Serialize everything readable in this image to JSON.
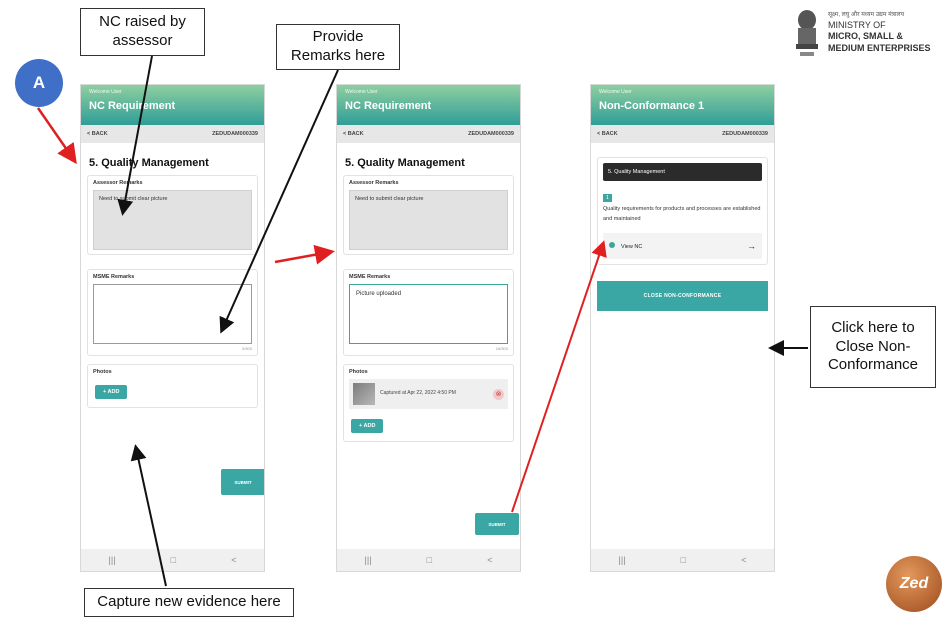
{
  "marker": "A",
  "callouts": {
    "nc_raised": "NC raised by assessor",
    "remarks": "Provide Remarks here",
    "capture": "Capture new evidence here",
    "close": "Click here to Close Non-Conformance"
  },
  "ministry": {
    "hindi": "सूक्ष्म, लघु और मध्यम उद्यम मंत्रालय",
    "line1": "MINISTRY OF",
    "line2": "MICRO, SMALL &",
    "line3": "MEDIUM ENTERPRISES"
  },
  "zed_logo": "Zed",
  "phone1": {
    "small": "Welcome User",
    "title": "NC Requirement",
    "back": "< BACK",
    "ref": "ZEDUDAM000339",
    "section": "5. Quality Management",
    "assessor_label": "Assessor Remarks",
    "assessor_text": "Need to submit clear picture",
    "msme_label": "MSME Remarks",
    "msme_text": "",
    "counter": "0/500",
    "photos_label": "Photos",
    "add": "+ ADD",
    "submit": "SUBMIT",
    "nav": [
      "|||",
      "□",
      "<"
    ]
  },
  "phone2": {
    "small": "Welcome User",
    "title": "NC Requirement",
    "back": "< BACK",
    "ref": "ZEDUDAM000339",
    "section": "5. Quality Management",
    "assessor_label": "Assessor Remarks",
    "assessor_text": "Need to submit clear picture",
    "msme_label": "MSME Remarks",
    "msme_text": "Picture uploaded",
    "counter": "16/500",
    "photos_label": "Photos",
    "photo_caption": "Captured at Apr 22, 2022 4:50 PM",
    "add": "+ ADD",
    "submit": "SUBMIT",
    "nav": [
      "|||",
      "□",
      "<"
    ]
  },
  "phone3": {
    "small": "Welcome User",
    "title": "Non-Conformance 1",
    "back": "< BACK",
    "ref": "ZEDUDAM000339",
    "section_head": "5. Quality Management",
    "badge": "1",
    "requirement": "Quality requirements for products and processes are established and maintained",
    "nc_item": "View NC",
    "close_btn": "CLOSE NON-CONFORMANCE",
    "nav": [
      "|||",
      "□",
      "<"
    ]
  },
  "colors": {
    "teal": "#3aa7a4",
    "arrow_red": "#e02020",
    "marker_blue": "#3f6fc6"
  }
}
